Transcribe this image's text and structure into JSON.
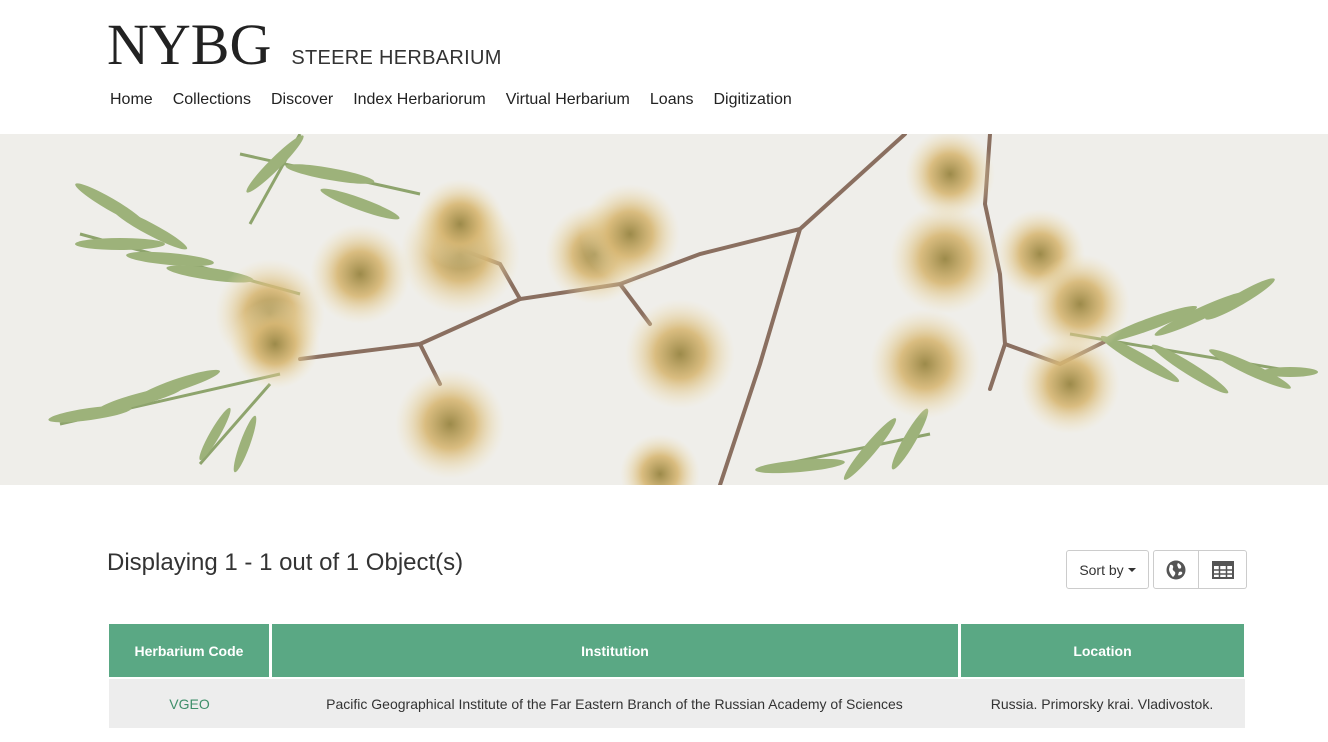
{
  "header": {
    "logo": "NYBG",
    "subtitle": "STEERE HERBARIUM"
  },
  "nav": {
    "items": [
      {
        "label": "Home"
      },
      {
        "label": "Collections"
      },
      {
        "label": "Discover"
      },
      {
        "label": "Index Herbariorum"
      },
      {
        "label": "Virtual Herbarium"
      },
      {
        "label": "Loans"
      },
      {
        "label": "Digitization"
      }
    ]
  },
  "results": {
    "count_text": "Displaying 1 - 1 out of 1 Object(s)",
    "sort_label": "Sort by",
    "map_view_icon": "globe-icon",
    "table_view_icon": "table-icon"
  },
  "table": {
    "headers": [
      "Herbarium Code",
      "Institution",
      "Location"
    ],
    "rows": [
      {
        "code": "VGEO",
        "institution": "Pacific Geographical Institute of the Far Eastern Branch of the Russian Academy of Sciences",
        "location": "Russia. Primorsky krai. Vladivostok."
      }
    ]
  },
  "colors": {
    "accent": "#5aa884",
    "link": "#3f8f6a",
    "row_bg": "#ededed"
  }
}
